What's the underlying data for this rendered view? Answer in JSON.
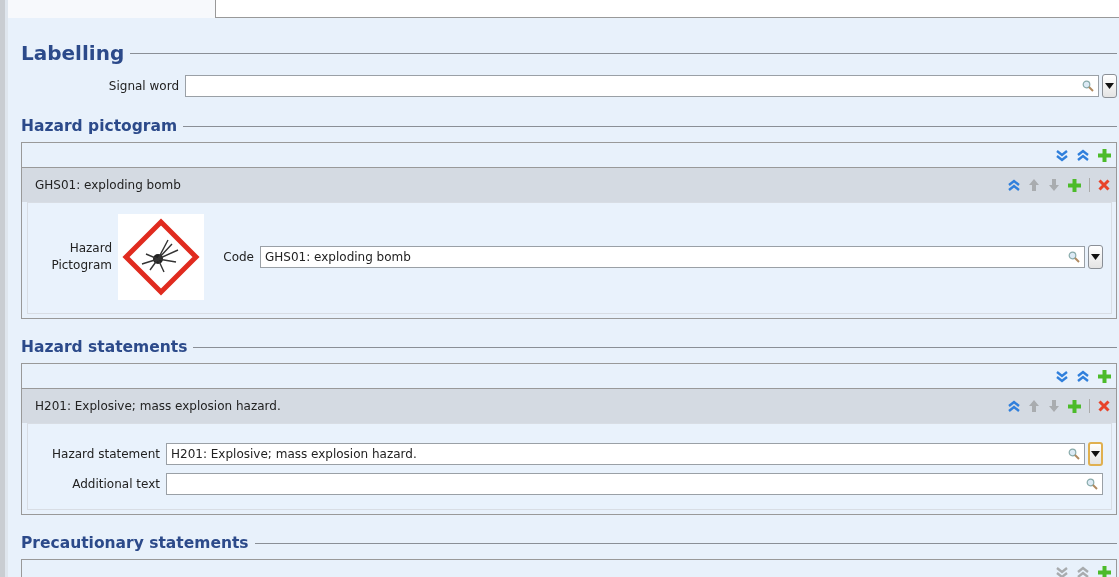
{
  "title": "Labelling",
  "signal_word": {
    "label": "Signal word",
    "has_dropdown": true
  },
  "sections": [
    {
      "title": "Hazard pictogram",
      "toolbar_enabled": true,
      "items": [
        {
          "header": "GHS01: exploding bomb",
          "move_up_enabled": false,
          "move_down_enabled": false,
          "pictogram": {
            "label": "Hazard Pictogram"
          },
          "fields": [
            {
              "label": "Code",
              "value": "GHS01: exploding bomb",
              "has_dropdown": true,
              "focused": false
            }
          ]
        }
      ]
    },
    {
      "title": "Hazard statements",
      "toolbar_enabled": true,
      "items": [
        {
          "header": "H201: Explosive; mass explosion hazard.",
          "move_up_enabled": false,
          "move_down_enabled": false,
          "fields": [
            {
              "label": "Hazard statement",
              "value": "H201: Explosive; mass explosion hazard.",
              "has_dropdown": true,
              "focused": true
            },
            {
              "label": "Additional text",
              "has_dropdown": false
            }
          ]
        }
      ]
    },
    {
      "title": "Precautionary statements",
      "toolbar_enabled": false
    }
  ]
}
